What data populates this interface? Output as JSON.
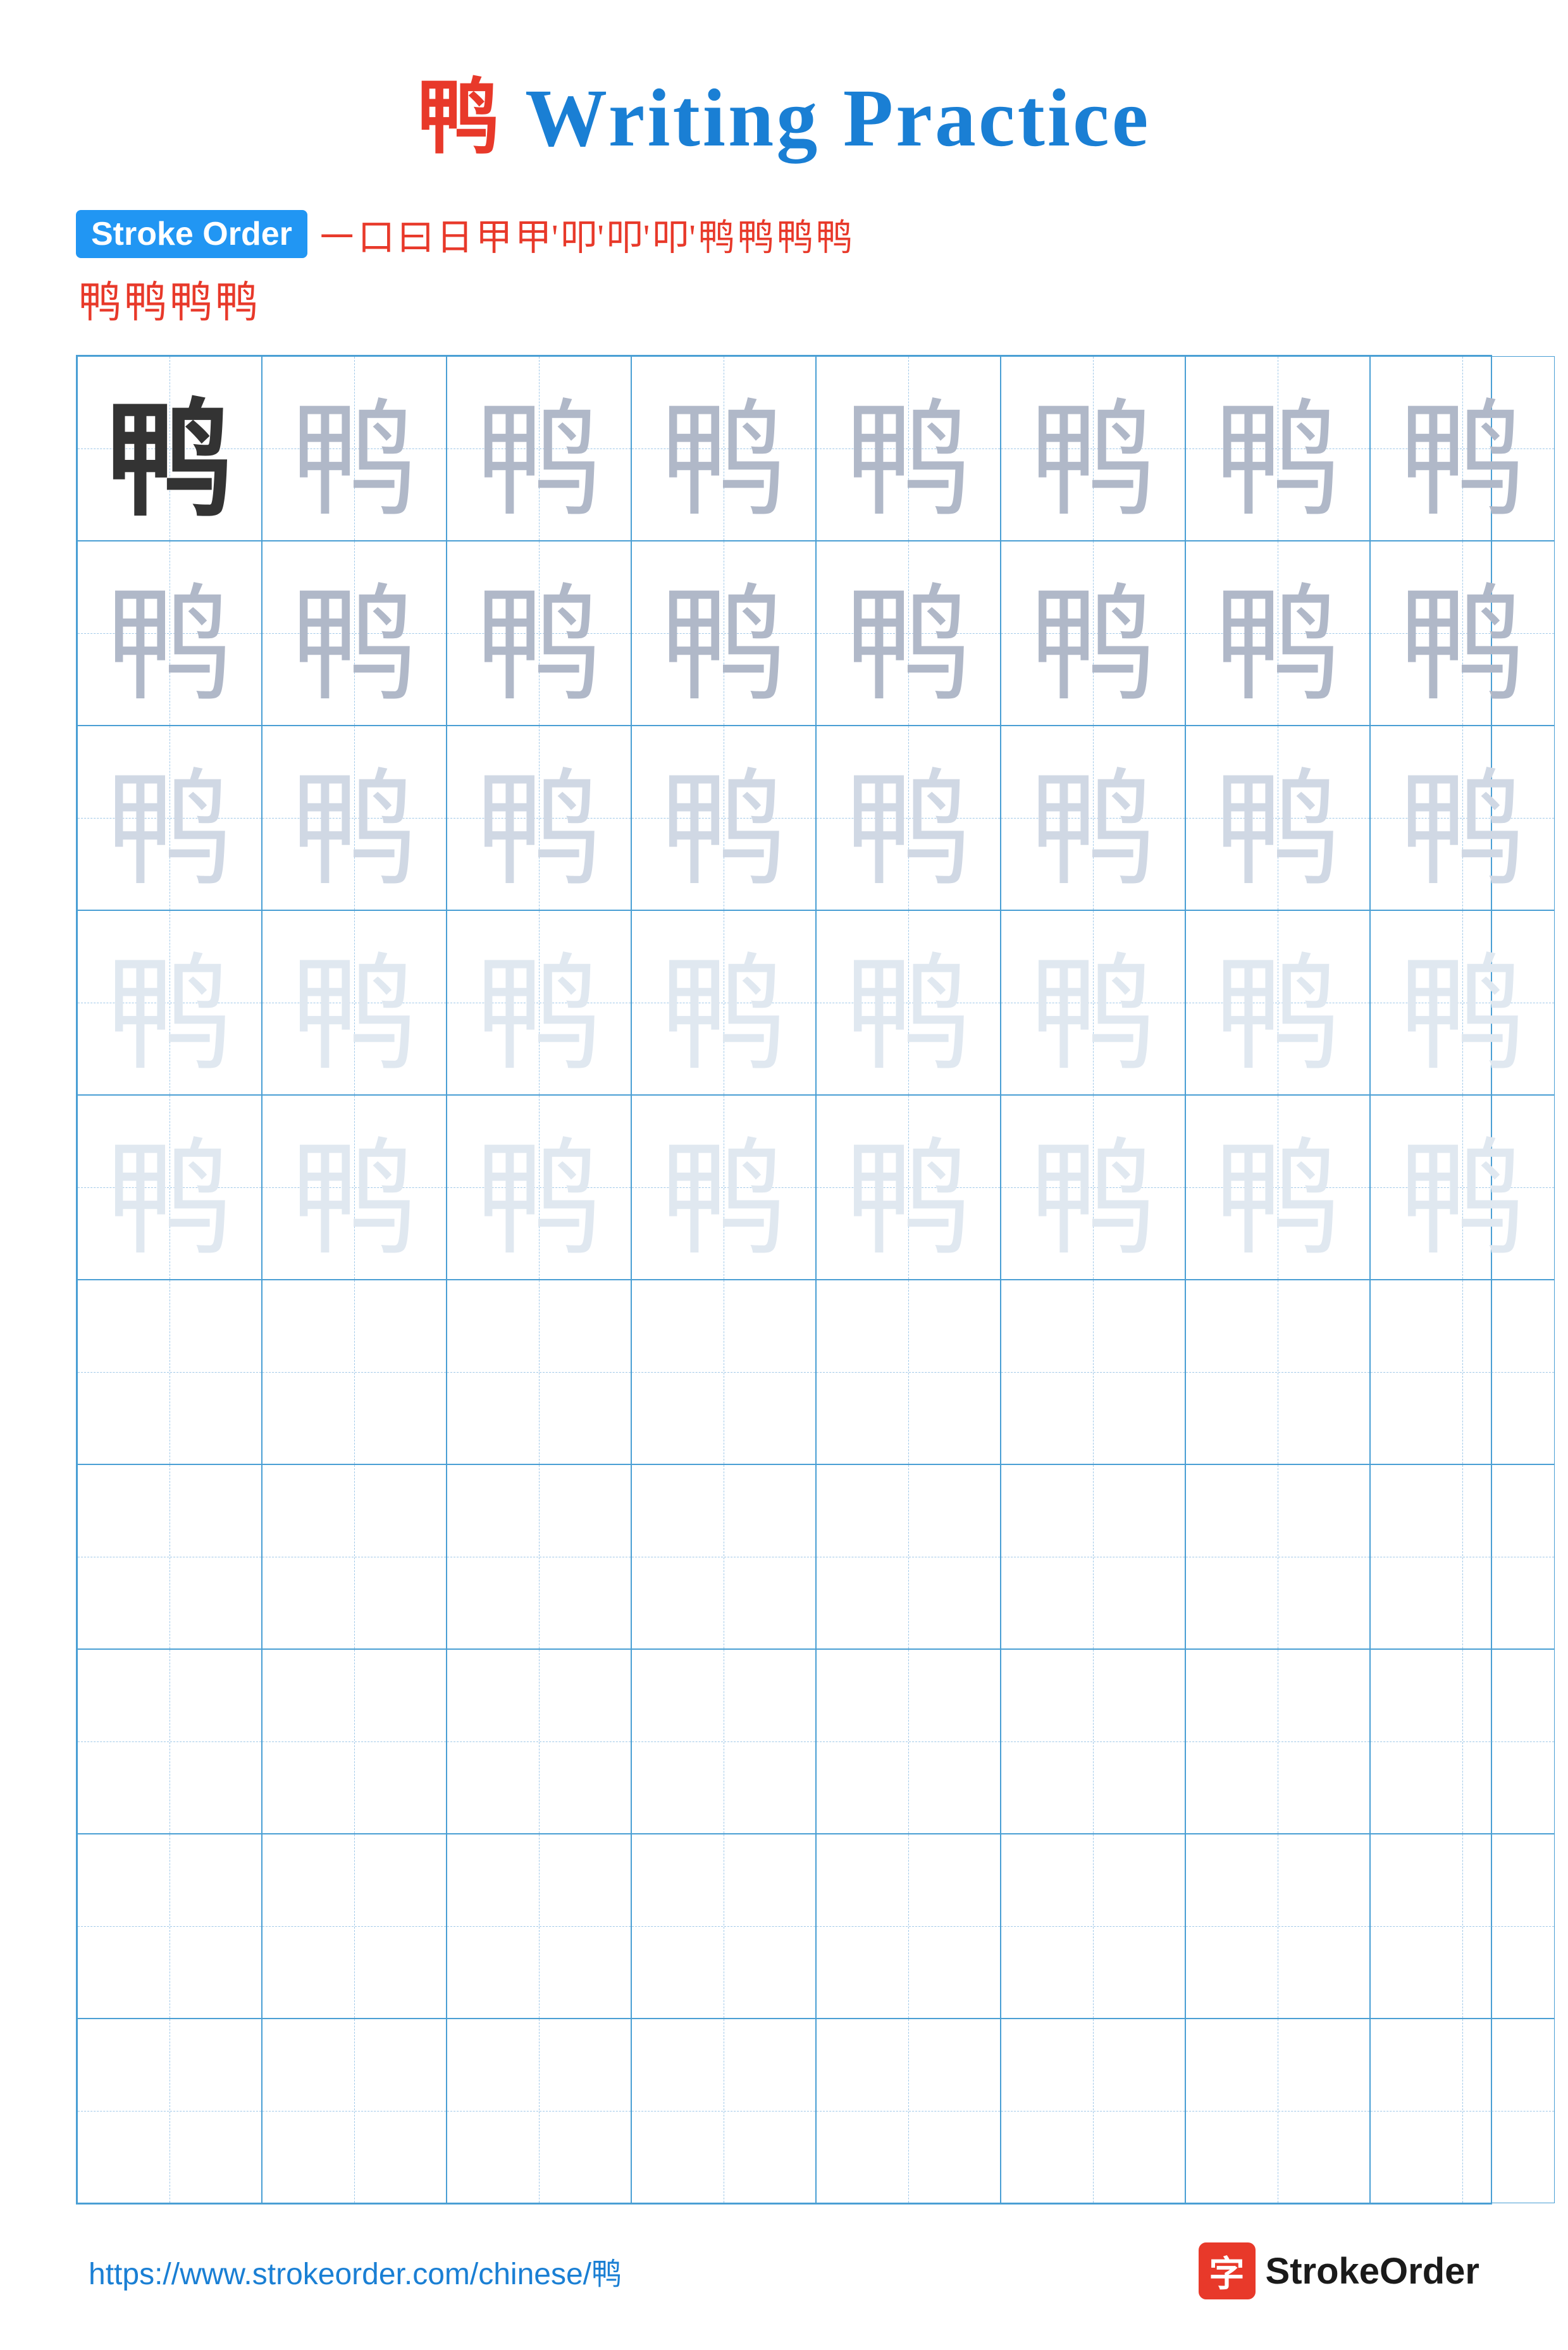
{
  "title": {
    "prefix_char": "鸭",
    "suffix": " Writing Practice"
  },
  "stroke_order": {
    "badge_label": "Stroke Order",
    "stroke_sequence": [
      "㇐",
      "口",
      "曰",
      "日",
      "甲",
      "甲'",
      "叩'",
      "叩'",
      "叩'",
      "鸭",
      "鸭",
      "鸭",
      "鸭",
      "鸭"
    ]
  },
  "grid": {
    "char": "鸭",
    "rows": 10,
    "cols": 8,
    "filled_rows": 5,
    "shades": [
      "dark",
      "medium",
      "medium",
      "light",
      "very-light"
    ]
  },
  "footer": {
    "url": "https://www.strokeorder.com/chinese/鸭",
    "logo_char": "字",
    "logo_name": "StrokeOrder"
  }
}
